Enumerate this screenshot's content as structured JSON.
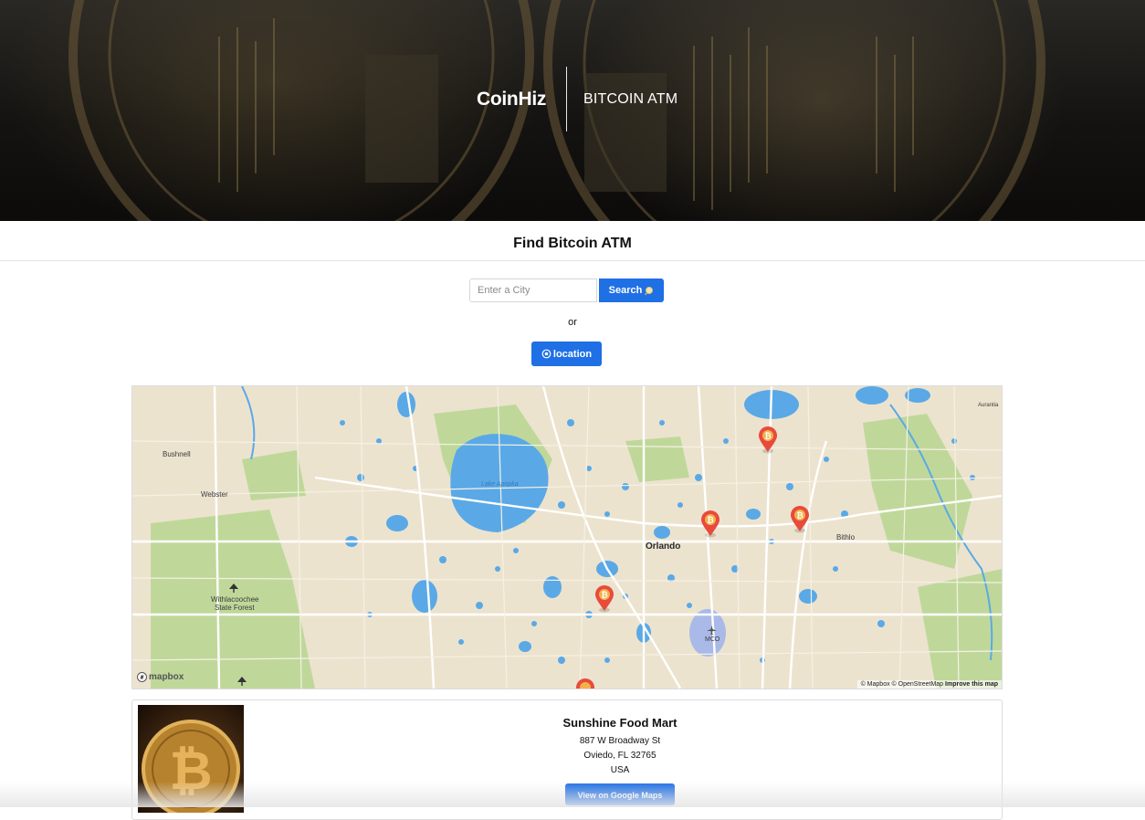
{
  "header": {
    "brand": "CoinHiz",
    "tagline": "BITCOIN ATM"
  },
  "section": {
    "title": "Find Bitcoin ATM"
  },
  "search": {
    "placeholder": "Enter a City",
    "value": "",
    "button_label": "Search",
    "or_text": "or",
    "location_label": "location"
  },
  "map": {
    "labels": {
      "bushnell": "Bushnell",
      "webster": "Webster",
      "lake_apopka": "Lake Apopka",
      "orlando": "Orlando",
      "bithlo": "Bithlo",
      "withlacoochee": "Withlacoochee",
      "state_forest": "State Forest",
      "mco": "MCO",
      "aurantia": "Aurantia"
    },
    "logo": "mapbox",
    "attribution": {
      "mapbox": "© Mapbox",
      "osm": "© OpenStreetMap",
      "improve": "Improve this map"
    },
    "marker_icon": "bitcoin-marker-icon",
    "colors": {
      "land": "#ece3cf",
      "water": "#5aa9e6",
      "park": "#bfd89a",
      "marker": "#e84a3c"
    }
  },
  "results": [
    {
      "name": "Sunshine Food Mart",
      "address1": "887 W Broadway St",
      "address2": "Oviedo, FL 32765",
      "country": "USA",
      "button_label": "View on Google Maps"
    }
  ],
  "colors": {
    "accent": "#1f6fe5"
  }
}
